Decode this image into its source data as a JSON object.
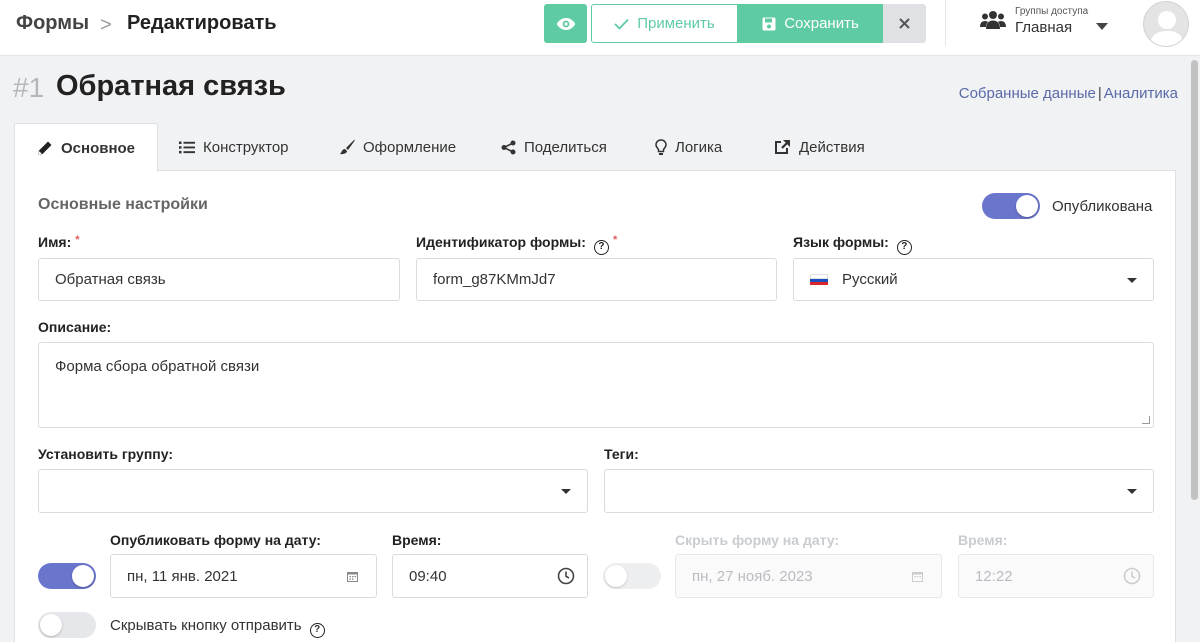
{
  "breadcrumb": {
    "root": "Формы",
    "separator": ">",
    "current": "Редактировать"
  },
  "toolbar": {
    "apply_label": "Применить",
    "save_label": "Сохранить"
  },
  "access": {
    "label": "Группы доступа",
    "value": "Главная"
  },
  "form": {
    "number": "#1",
    "title": "Обратная связь"
  },
  "links": {
    "collected": "Собранные данные",
    "separator": "|",
    "analytics": "Аналитика"
  },
  "tabs": [
    {
      "label": "Основное",
      "icon": "pencil-icon",
      "active": true
    },
    {
      "label": "Конструктор",
      "icon": "list-icon"
    },
    {
      "label": "Оформление",
      "icon": "brush-icon"
    },
    {
      "label": "Поделиться",
      "icon": "share-icon"
    },
    {
      "label": "Логика",
      "icon": "lightbulb-icon"
    },
    {
      "label": "Действия",
      "icon": "external-icon"
    }
  ],
  "settings": {
    "section_title": "Основные настройки",
    "published_label": "Опубликована",
    "published": true,
    "name_label": "Имя:",
    "name_value": "Обратная связь",
    "id_label": "Идентификатор формы:",
    "id_value": "form_g87KMmJd7",
    "lang_label": "Язык формы:",
    "lang_value": "Русский",
    "desc_label": "Описание:",
    "desc_value": "Форма сбора обратной связи",
    "group_label": "Установить группу:",
    "group_value": "",
    "tags_label": "Теги:",
    "tags_value": "",
    "publish_date_label": "Опубликовать форму на дату:",
    "publish_date_value": "пн, 11 янв. 2021",
    "publish_time_label": "Время:",
    "publish_time_value": "09:40",
    "hide_date_label": "Скрыть форму на дату:",
    "hide_date_value": "пн, 27 нояб. 2023",
    "hide_time_label": "Время:",
    "hide_time_value": "12:22",
    "hide_button_label": "Скрывать кнопку отправить",
    "required_mark": "*",
    "help_mark": "?"
  },
  "colors": {
    "accent_green": "#5ecba3",
    "toggle_on": "#6a76cc",
    "link": "#5a6aa8"
  }
}
